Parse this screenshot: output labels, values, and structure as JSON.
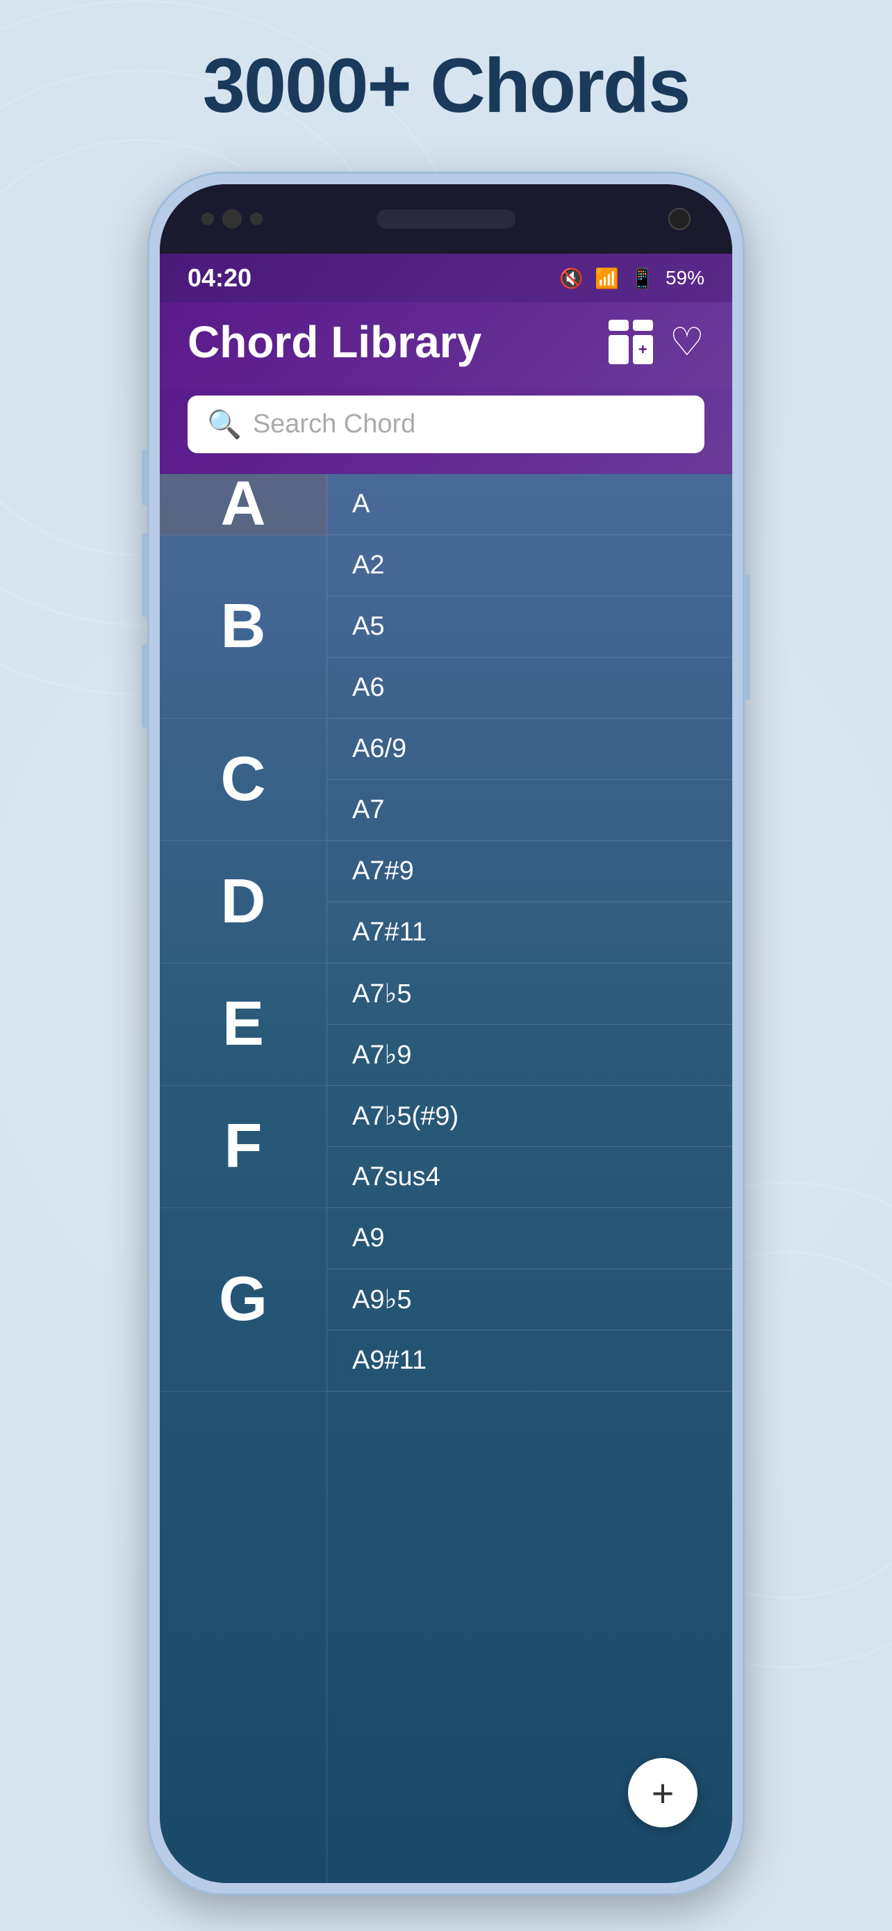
{
  "page": {
    "title": "3000+ Chords"
  },
  "status_bar": {
    "time": "04:20",
    "battery": "59%",
    "icons": [
      "mute",
      "wifi",
      "signal1",
      "signal2",
      "battery"
    ]
  },
  "app": {
    "title": "Chord Library",
    "search_placeholder": "Search Chord",
    "add_label": "+",
    "heart_icon": "♡",
    "grid_icon": "⊞"
  },
  "letters": [
    {
      "letter": "A",
      "active": true
    },
    {
      "letter": "B",
      "active": false
    },
    {
      "letter": "C",
      "active": false
    },
    {
      "letter": "D",
      "active": false
    },
    {
      "letter": "E",
      "active": false
    },
    {
      "letter": "F",
      "active": false
    },
    {
      "letter": "G",
      "active": false
    }
  ],
  "chords": [
    "A",
    "A2",
    "A5",
    "A6",
    "A6/9",
    "A7",
    "A7#9",
    "A7#11",
    "A7♭5",
    "A7♭9",
    "A7♭5(#9)",
    "A7sus4",
    "A9",
    "A9♭5",
    "A9#11"
  ],
  "fab": {
    "label": "+"
  }
}
